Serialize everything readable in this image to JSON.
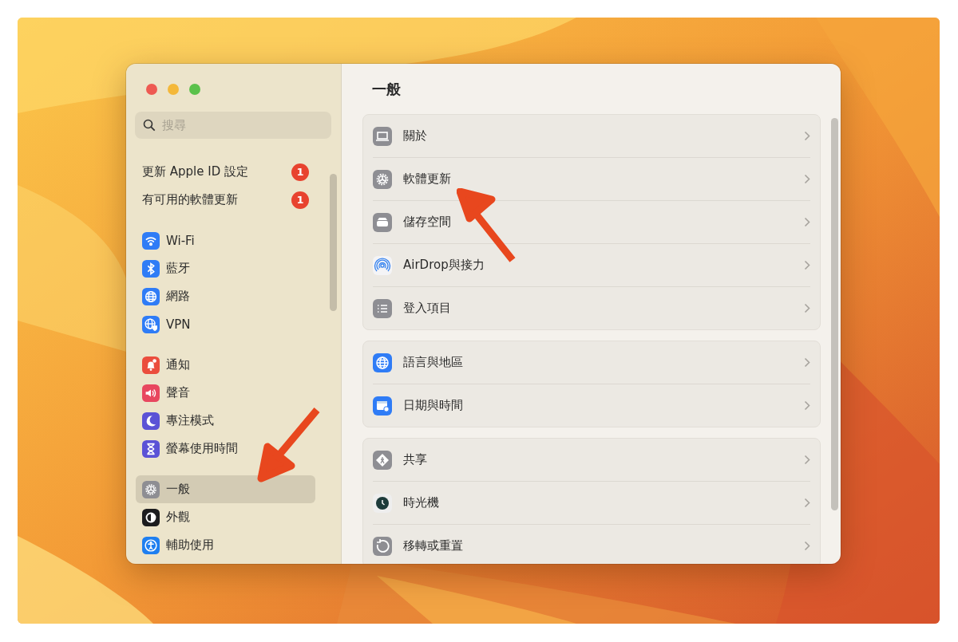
{
  "sidebar": {
    "search": {
      "placeholder": "搜尋"
    },
    "notices": [
      {
        "label": "更新 Apple ID 設定",
        "badge": "1"
      },
      {
        "label": "有可用的軟體更新",
        "badge": "1"
      }
    ],
    "groups": [
      [
        {
          "label": "Wi-Fi",
          "color": "#2f7cf6",
          "selected": false
        },
        {
          "label": "藍牙",
          "color": "#2f7cf6",
          "selected": false
        },
        {
          "label": "網路",
          "color": "#2f7cf6",
          "selected": false
        },
        {
          "label": "VPN",
          "color": "#2f7cf6",
          "selected": false
        }
      ],
      [
        {
          "label": "通知",
          "color": "#eb4d3d",
          "selected": false
        },
        {
          "label": "聲音",
          "color": "#e8475f",
          "selected": false
        },
        {
          "label": "專注模式",
          "color": "#5b52d6",
          "selected": false
        },
        {
          "label": "螢幕使用時間",
          "color": "#5b52d6",
          "selected": false
        }
      ],
      [
        {
          "label": "一般",
          "color": "#8e8e93",
          "selected": true
        },
        {
          "label": "外觀",
          "color": "#1c1c1e",
          "selected": false
        },
        {
          "label": "輔助使用",
          "color": "#1f7ff0",
          "selected": false
        }
      ]
    ]
  },
  "content": {
    "title": "一般",
    "groups": [
      [
        {
          "label": "關於",
          "color": "#8e8e93"
        },
        {
          "label": "軟體更新",
          "color": "#8e8e93"
        },
        {
          "label": "儲存空間",
          "color": "#8e8e93"
        },
        {
          "label": "AirDrop與接力",
          "color": "#f4f4f6"
        },
        {
          "label": "登入項目",
          "color": "#8e8e93"
        }
      ],
      [
        {
          "label": "語言與地區",
          "color": "#2f7cf6"
        },
        {
          "label": "日期與時間",
          "color": "#2f7cf6"
        }
      ],
      [
        {
          "label": "共享",
          "color": "#8e8e93"
        },
        {
          "label": "時光機",
          "color": "#eeeeee"
        },
        {
          "label": "移轉或重置",
          "color": "#8e8e93"
        }
      ]
    ]
  }
}
